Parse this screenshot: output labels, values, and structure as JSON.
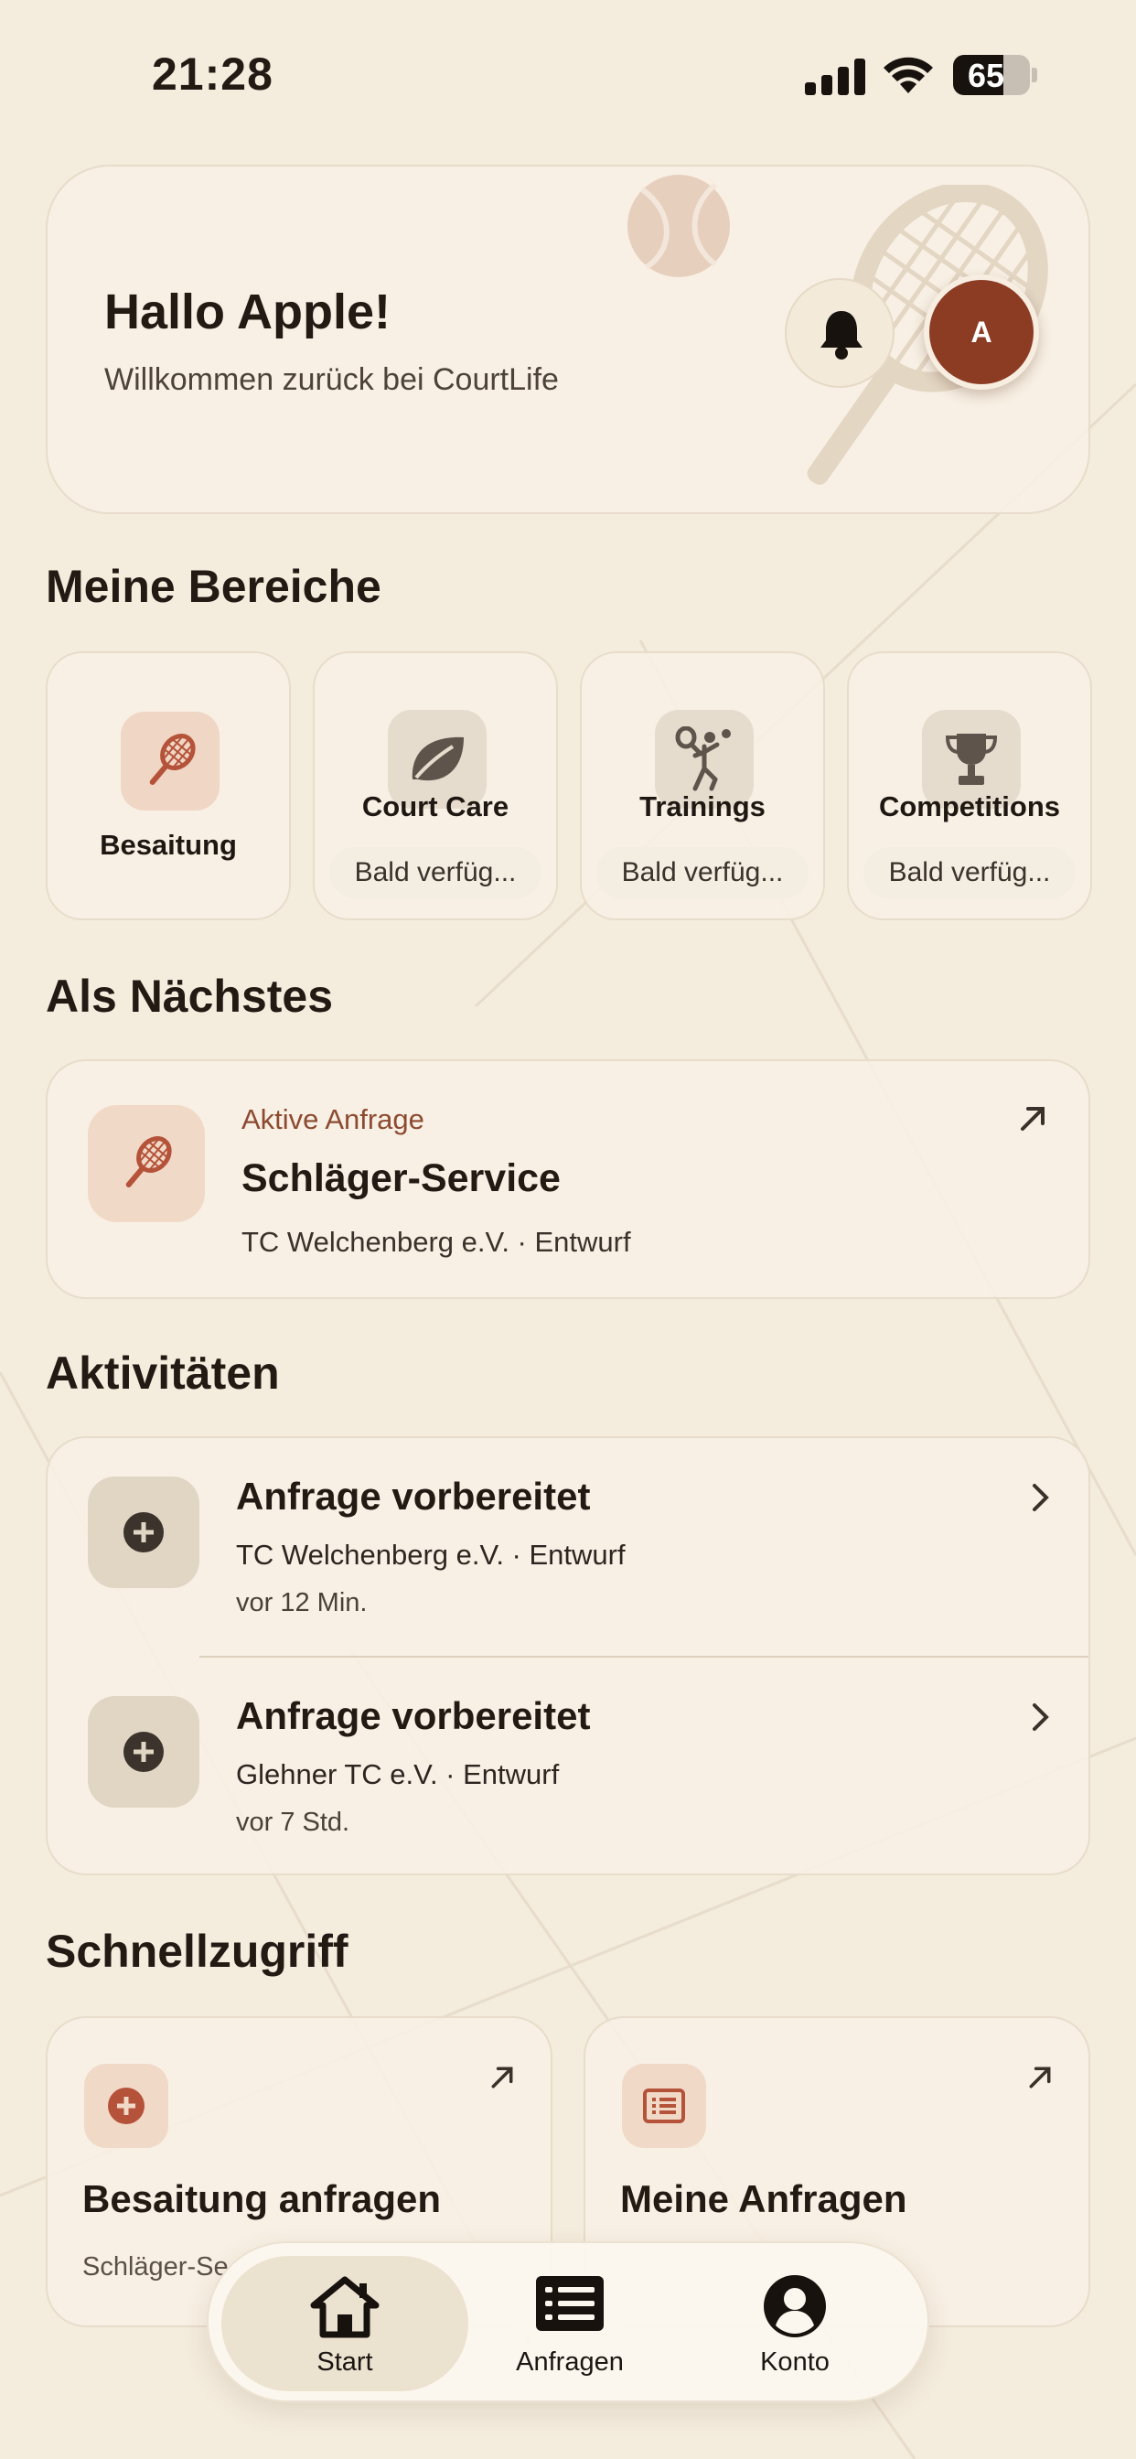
{
  "status_bar": {
    "time": "21:28",
    "battery": "65",
    "battery_level": 0.65
  },
  "header": {
    "greeting": "Hallo Apple!",
    "welcome": "Willkommen zurück bei CourtLife",
    "avatar_initial": "A",
    "bell_icon": "bell-icon"
  },
  "areas": {
    "title": "Meine Bereiche",
    "items": [
      {
        "label": "Besaitung",
        "icon": "racket-icon",
        "badge": ""
      },
      {
        "label": "Court Care",
        "icon": "leaf-icon",
        "badge": "Bald verfüg..."
      },
      {
        "label": "Trainings",
        "icon": "player-icon",
        "badge": "Bald verfüg..."
      },
      {
        "label": "Competitions",
        "icon": "trophy-icon",
        "badge": "Bald verfüg..."
      }
    ]
  },
  "next": {
    "title": "Als Nächstes",
    "tag": "Aktive Anfrage",
    "card_title": "Schläger-Service",
    "subtitle": "TC Welchenberg e.V. · Entwurf"
  },
  "activities": {
    "title": "Aktivitäten",
    "items": [
      {
        "title": "Anfrage vorbereitet",
        "subtitle": "TC Welchenberg e.V. · Entwurf",
        "time": "vor 12 Min."
      },
      {
        "title": "Anfrage vorbereitet",
        "subtitle": "Glehner TC e.V. · Entwurf",
        "time": "vor 7 Std."
      }
    ]
  },
  "quick": {
    "title": "Schnellzugriff",
    "items": [
      {
        "title": "Besaitung anfragen",
        "subtitle": "Schläger-Se",
        "icon": "plus-circle-icon"
      },
      {
        "title": "Meine Anfragen",
        "subtitle": "",
        "icon": "list-icon"
      }
    ]
  },
  "tabs": [
    {
      "label": "Start",
      "icon": "home-icon",
      "active": true
    },
    {
      "label": "Anfragen",
      "icon": "list-icon",
      "active": false
    },
    {
      "label": "Konto",
      "icon": "person-icon",
      "active": false
    }
  ],
  "colors": {
    "background": "#f4ecdd",
    "accent": "#8d3c24",
    "accent_light": "#f1d9c8",
    "text": "#231a14"
  }
}
